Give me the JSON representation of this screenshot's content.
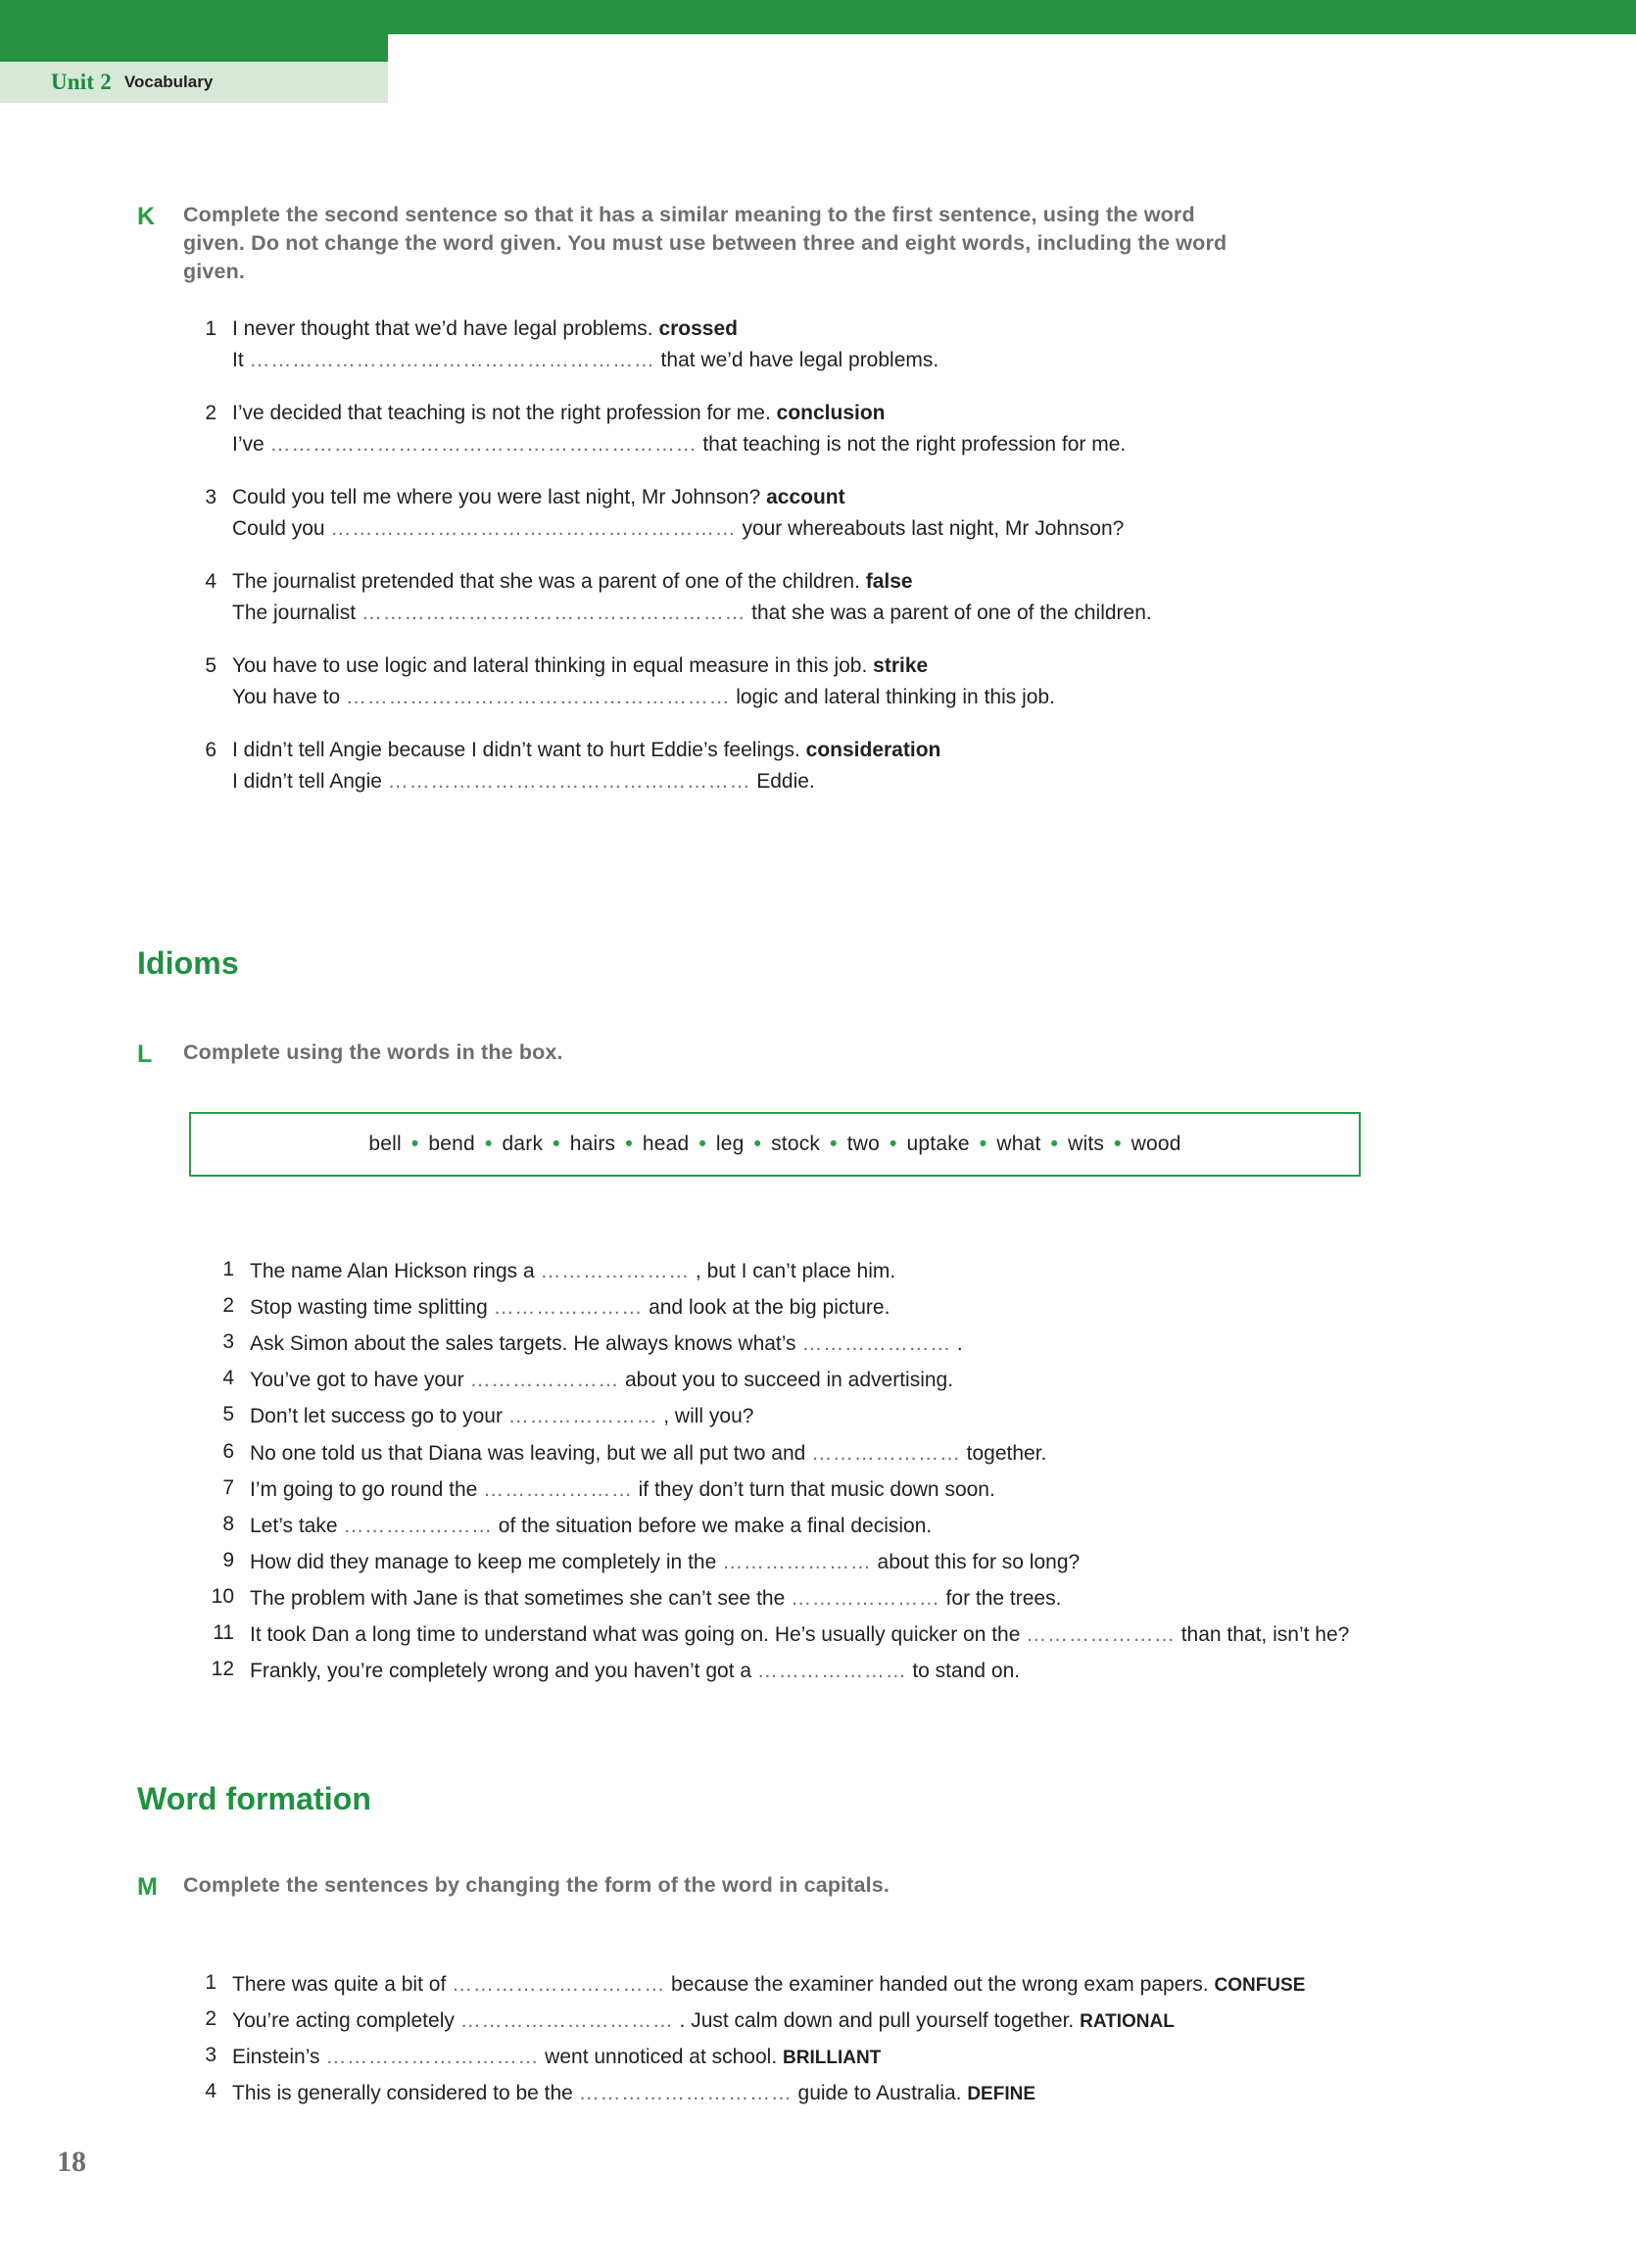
{
  "header": {
    "unit_label": "Unit 2",
    "section_label": "Vocabulary",
    "bar_color": "#259141",
    "tab_color": "#d7e8d9"
  },
  "page_number": "18",
  "exercises": [
    {
      "letter": "K",
      "instruction": "Complete the second sentence so that it has a similar meaning to the first sentence, using the word given. Do not change the word given. You must use between three and eight words, including the word given.",
      "items": [
        {
          "num": "1",
          "line1_pre": "I never thought that we’d have legal problems. ",
          "line1_keyword": "crossed",
          "line2_pre": "It ",
          "line2_dots": "…………………………………………………",
          "line2_post": " that we’d have legal problems."
        },
        {
          "num": "2",
          "line1_pre": "I’ve decided that teaching is not the right profession for me. ",
          "line1_keyword": "conclusion",
          "line2_pre": "I’ve ",
          "line2_dots": "……………………………………………………",
          "line2_post": " that teaching is not the right profession for me."
        },
        {
          "num": "3",
          "line1_pre": "Could you tell me where you were last night, Mr Johnson? ",
          "line1_keyword": "account",
          "line2_pre": "Could you ",
          "line2_dots": "…………………………………………………",
          "line2_post": " your whereabouts last night, Mr Johnson?"
        },
        {
          "num": "4",
          "line1_pre": "The journalist pretended that she was a parent of one of the children. ",
          "line1_keyword": "false",
          "line2_pre": "The journalist ",
          "line2_dots": "………………………………………………",
          "line2_post": " that she was a parent of one of the children."
        },
        {
          "num": "5",
          "line1_pre": "You have to use logic and lateral thinking in equal measure in this job. ",
          "line1_keyword": "strike",
          "line2_pre": "You have to ",
          "line2_dots": "………………………………………………",
          "line2_post": " logic and lateral thinking in this job."
        },
        {
          "num": "6",
          "line1_pre": "I didn’t tell Angie because I didn’t want to hurt Eddie’s feelings. ",
          "line1_keyword": "consideration",
          "line2_pre": "I didn’t tell Angie ",
          "line2_dots": "……………………………………………",
          "line2_post": " Eddie."
        }
      ]
    }
  ],
  "idioms": {
    "heading": "Idioms",
    "letter": "L",
    "instruction": "Complete using the words in the box.",
    "word_box": {
      "border_color": "#2a9c46",
      "separator": "•",
      "words": [
        "bell",
        "bend",
        "dark",
        "hairs",
        "head",
        "leg",
        "stock",
        "two",
        "uptake",
        "what",
        "wits",
        "wood"
      ]
    },
    "items": [
      {
        "num": "1",
        "pre": "The name Alan Hickson rings a ",
        "dots": "…………………",
        "post": " , but I can’t place him."
      },
      {
        "num": "2",
        "pre": "Stop wasting time splitting ",
        "dots": "…………………",
        "post": " and look at the big picture."
      },
      {
        "num": "3",
        "pre": "Ask Simon about the sales targets. He always knows what’s ",
        "dots": "…………………",
        "post": " ."
      },
      {
        "num": "4",
        "pre": "You’ve got to have your ",
        "dots": "…………………",
        "post": " about you to succeed in advertising."
      },
      {
        "num": "5",
        "pre": "Don’t let success go to your ",
        "dots": "…………………",
        "post": " , will you?"
      },
      {
        "num": "6",
        "pre": "No one told us that Diana was leaving, but we all put two and ",
        "dots": "…………………",
        "post": " together."
      },
      {
        "num": "7",
        "pre": "I’m going to go round the ",
        "dots": "…………………",
        "post": " if they don’t turn that music down soon."
      },
      {
        "num": "8",
        "pre": "Let’s take ",
        "dots": "…………………",
        "post": " of the situation before we make a final decision."
      },
      {
        "num": "9",
        "pre": "How did they manage to keep me completely in the ",
        "dots": "…………………",
        "post": " about this for so long?"
      },
      {
        "num": "10",
        "pre": "The problem with Jane is that sometimes she can’t see the ",
        "dots": "…………………",
        "post": " for the trees."
      },
      {
        "num": "11",
        "pre": "It took Dan a long time to understand what was going on. He’s usually quicker on the ",
        "dots": "…………………",
        "post": " than that, isn’t he?"
      },
      {
        "num": "12",
        "pre": "Frankly, you’re completely wrong and you haven’t got a ",
        "dots": "…………………",
        "post": " to stand on."
      }
    ]
  },
  "word_formation": {
    "heading": "Word formation",
    "letter": "M",
    "instruction": "Complete the sentences by changing the form of the word in capitals.",
    "items": [
      {
        "num": "1",
        "pre": "There was quite a bit of ",
        "dots": "…………………………",
        "post": " because the examiner handed out the wrong exam papers. ",
        "capital": "CONFUSE"
      },
      {
        "num": "2",
        "pre": "You’re acting completely ",
        "dots": "…………………………",
        "post": " . Just calm down and pull yourself together. ",
        "capital": "RATIONAL"
      },
      {
        "num": "3",
        "pre": "Einstein’s ",
        "dots": "…………………………",
        "post": " went unnoticed at school. ",
        "capital": "BRILLIANT"
      },
      {
        "num": "4",
        "pre": "This is generally considered to be the ",
        "dots": "…………………………",
        "post": " guide to Australia. ",
        "capital": "DEFINE"
      }
    ]
  }
}
